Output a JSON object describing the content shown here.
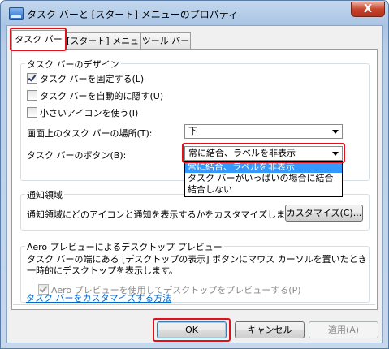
{
  "window": {
    "title": "タスク バーと [スタート] メニューのプロパティ",
    "close_glyph": "X"
  },
  "tabs": [
    {
      "label": "タスク バー"
    },
    {
      "label": "[スタート] メニュー"
    },
    {
      "label": "ツール バー"
    }
  ],
  "design_group": {
    "label": "タスク バーのデザイン",
    "options": [
      {
        "label": "タスク バーを固定する(L)",
        "checked": true
      },
      {
        "label": "タスク バーを自動的に隠す(U)",
        "checked": false
      },
      {
        "label": "小さいアイコンを使う(I)",
        "checked": false
      }
    ],
    "location_label": "画面上のタスク バーの場所(T):",
    "location_value": "下",
    "buttons_label": "タスク バーのボタン(B):",
    "buttons_value": "常に結合、ラベルを非表示",
    "buttons_options": [
      "常に結合、ラベルを非表示",
      "タスク バーがいっぱいの場合に結合",
      "結合しない"
    ]
  },
  "notify_group": {
    "label": "通知領域",
    "description": "通知領域にどのアイコンと通知を表示するかをカスタマイズします。",
    "customize_button": "カスタマイズ(C)..."
  },
  "aero_group": {
    "label": "Aero プレビューによるデスクトップ プレビュー",
    "description_line1": "タスク バーの端にある [デスクトップの表示] ボタンにマウス カーソルを置いたときに、",
    "description_line2": "一時的にデスクトップを表示します。",
    "checkbox_label": "Aero プレビューを使用してデスクトップをプレビューする(P)"
  },
  "help_link": "タスク バーをカスタマイズする方法",
  "footer": {
    "ok": "OK",
    "cancel": "キャンセル",
    "apply": "適用(A)"
  },
  "colors": {
    "highlight_box": "#e0111b",
    "selection": "#3399ff",
    "link": "#0066cc"
  }
}
